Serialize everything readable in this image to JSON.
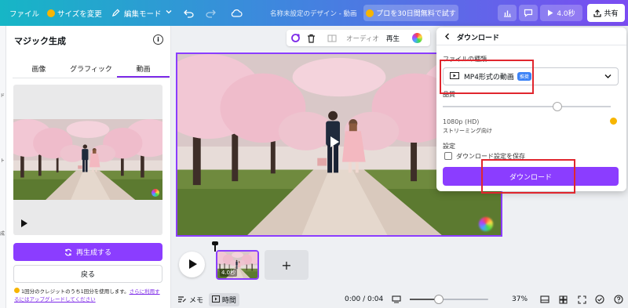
{
  "topbar": {
    "file": "ファイル",
    "resize": "サイズを変更",
    "edit_mode": "編集モード",
    "doc_title": "名称未設定のデザイン - 動画",
    "pro_trial": "プロを30日間無料で試す",
    "duration": "4.0秒",
    "share": "共有"
  },
  "left_strip": [
    "ド",
    "ト",
    "成"
  ],
  "panel": {
    "title": "マジック生成",
    "tabs": [
      "画像",
      "グラフィック",
      "動画"
    ],
    "active_tab": "動画",
    "regenerate": "再生成する",
    "back": "戻る",
    "credit_text": "1回分のクレジットのうち1回分を使用します。",
    "credit_link_1": "さらに利用す",
    "credit_link_2": "るにはアップグレードしてください"
  },
  "canvas_toolbar": {
    "audio": "オーディオ",
    "play": "再生"
  },
  "timeline": {
    "clip_duration": "4.0秒",
    "add": "+"
  },
  "bottom": {
    "notes": "メモ",
    "timing": "時間",
    "time": "0:00 / 0:04",
    "zoom": "37%",
    "zoom_level": 0.37
  },
  "download": {
    "title": "ダウンロード",
    "file_type_label": "ファイルの種類",
    "file_type_value": "MP4形式の動画",
    "recommended": "推奨",
    "quality_label": "品質",
    "quality_value": "1080p (HD)",
    "quality_note": "ストリーミング向け",
    "quality_level": 0.68,
    "settings_label": "設定",
    "save_settings": "ダウンロード設定を保存",
    "button": "ダウンロード"
  },
  "colors": {
    "accent": "#8b3dff",
    "highlight": "#e0262e"
  }
}
